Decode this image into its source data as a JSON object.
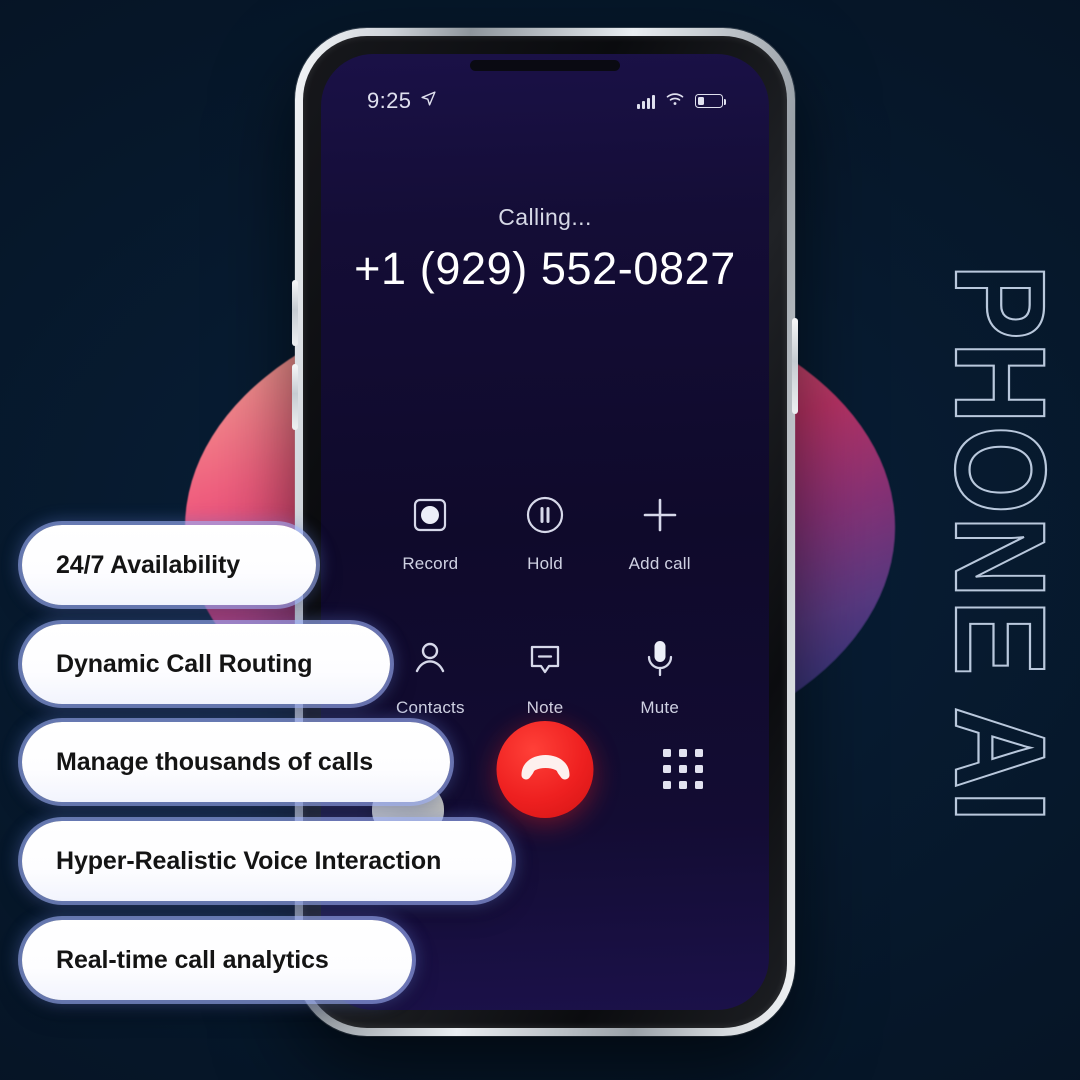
{
  "theme": {
    "background": "#061628",
    "accent_blue": "#a4b6ff",
    "end_call_red": "#ee2020",
    "pill_text": "#141414",
    "brand_outline": "#b9c8dc"
  },
  "brand": {
    "text": "PHONE AI",
    "orientation": "vertical-rotated-90"
  },
  "phone": {
    "status_bar": {
      "time": "9:25",
      "location_icon": "location-arrow-icon",
      "signal_icon": "signal-bars-icon",
      "wifi_icon": "wifi-icon",
      "battery_icon": "battery-low-icon",
      "battery_level_percent": 26
    },
    "call": {
      "status_label": "Calling...",
      "number": "+1 (929) 552-0827"
    },
    "actions": [
      {
        "label": "Record",
        "icon": "record-icon"
      },
      {
        "label": "Hold",
        "icon": "pause-circle-icon"
      },
      {
        "label": "Add call",
        "icon": "plus-icon"
      },
      {
        "label": "Contacts",
        "icon": "person-icon"
      },
      {
        "label": "Note",
        "icon": "note-bubble-icon"
      },
      {
        "label": "Mute",
        "icon": "microphone-icon"
      }
    ],
    "bottom": {
      "end_call_icon": "end-call-handset-icon",
      "keypad_icon": "keypad-grid-icon"
    }
  },
  "features": [
    {
      "label": "24/7 Availability"
    },
    {
      "label": "Dynamic Call Routing"
    },
    {
      "label": "Manage thousands of calls"
    },
    {
      "label": "Hyper-Realistic Voice Interaction"
    },
    {
      "label": "Real-time call analytics"
    }
  ]
}
